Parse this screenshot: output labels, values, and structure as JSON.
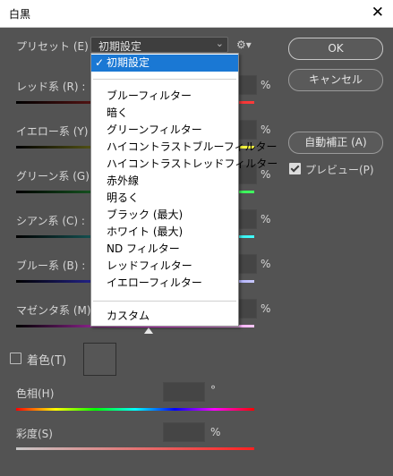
{
  "window": {
    "title": "白黒",
    "close_glyph": "✕"
  },
  "preset": {
    "label": "プリセット (E) :",
    "value": "初期設定",
    "gear_glyph": "⚙▾"
  },
  "buttons": {
    "ok": "OK",
    "cancel": "キャンセル",
    "auto": "自動補正 (A)"
  },
  "preview": {
    "label": "プレビュー(P)",
    "checked": true
  },
  "sliders": [
    {
      "label": "レッド系 (R) :",
      "value": "",
      "unit": "%"
    },
    {
      "label": "イエロー系 (Y) :",
      "value": "",
      "unit": "%"
    },
    {
      "label": "グリーン系 (G) :",
      "value": "",
      "unit": "%"
    },
    {
      "label": "シアン系 (C) :",
      "value": "",
      "unit": "%"
    },
    {
      "label": "ブルー系 (B) :",
      "value": "",
      "unit": "%"
    },
    {
      "label": "マゼンタ系 (M) :",
      "value": "",
      "unit": "%"
    }
  ],
  "tint": {
    "label": "着色(T)",
    "checked": false,
    "hue": {
      "label": "色相(H)",
      "value": "",
      "unit": "°"
    },
    "saturation": {
      "label": "彩度(S)",
      "value": "",
      "unit": "%"
    }
  },
  "menu": {
    "selected": "初期設定",
    "check_glyph": "✓",
    "items": [
      "ブルーフィルター",
      "暗く",
      "グリーンフィルター",
      "ハイコントラストブルーフィルター",
      "ハイコントラストレッドフィルター",
      "赤外線",
      "明るく",
      "ブラック (最大)",
      "ホワイト (最大)",
      "ND フィルター",
      "レッドフィルター",
      "イエローフィルター"
    ],
    "custom": "カスタム"
  }
}
